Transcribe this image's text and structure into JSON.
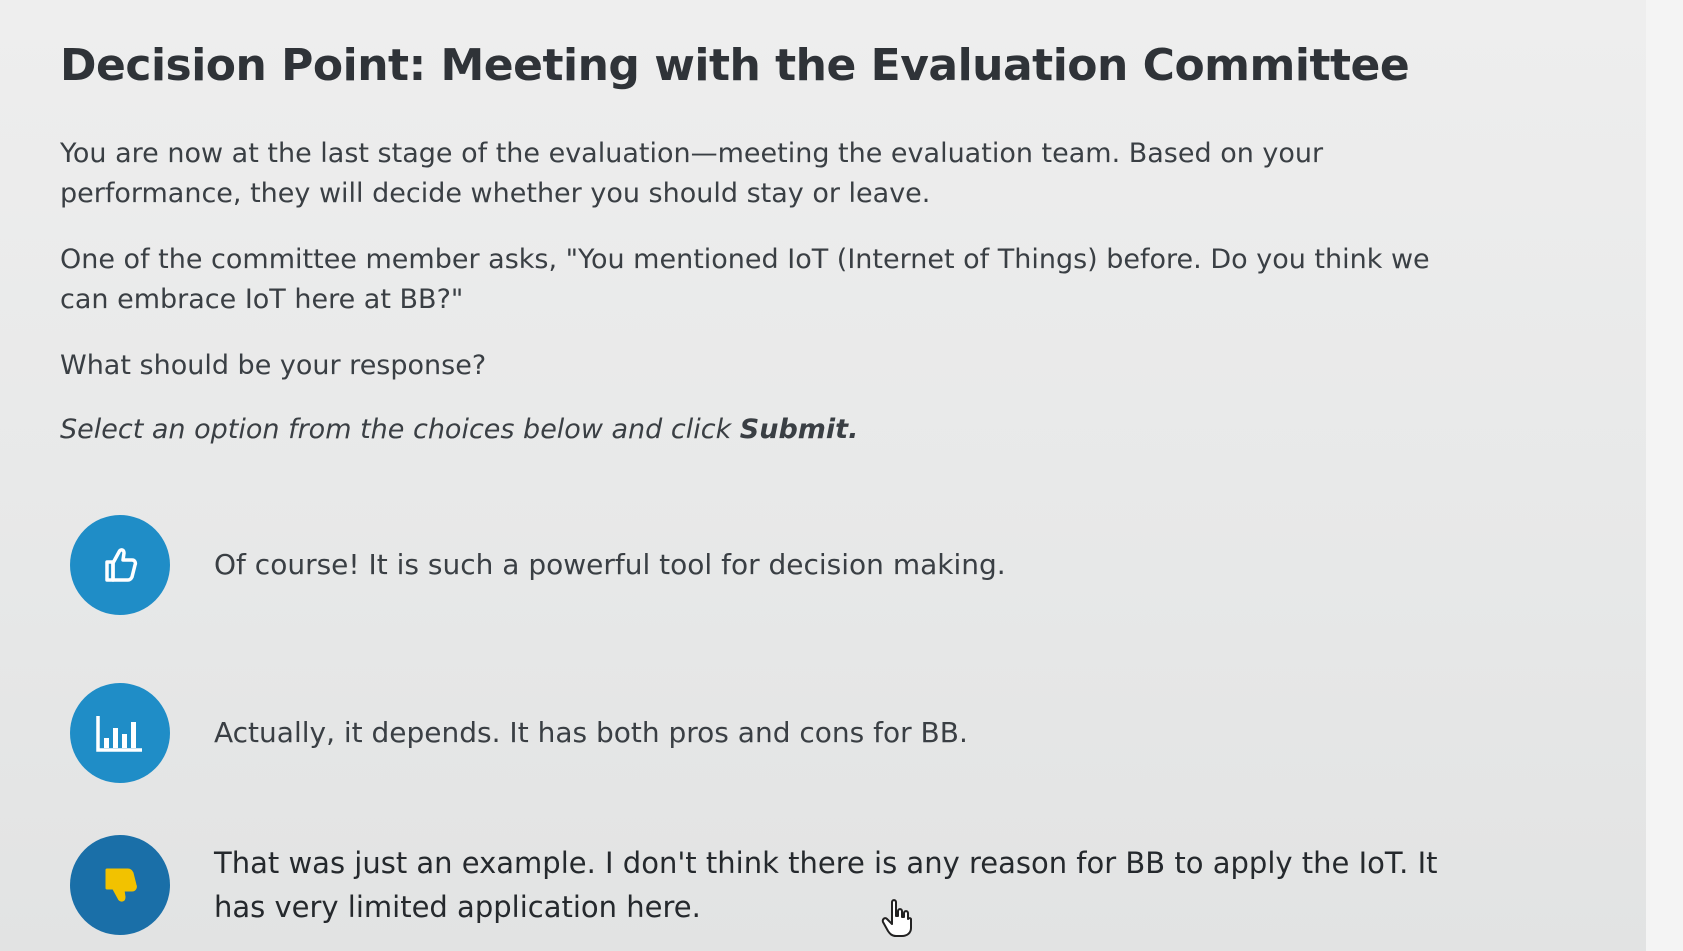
{
  "title": "Decision Point: Meeting with the Evaluation Committee",
  "paragraphs": {
    "intro": "You are now at the last stage of the evaluation—meeting the evaluation team. Based on your performance, they will decide whether you should stay or leave.",
    "question": "One of the committee member asks, \"You mentioned IoT (Internet of Things) before. Do you think we can embrace IoT here at BB?\"",
    "prompt": "What should be your response?",
    "instruction_prefix": "Select an option from the choices below and click ",
    "instruction_strong": "Submit."
  },
  "choices": [
    {
      "icon": "thumbs-up-icon",
      "text": "Of course! It is such a powerful tool for decision making."
    },
    {
      "icon": "bar-chart-icon",
      "text": "Actually, it depends. It has both pros and cons for BB."
    },
    {
      "icon": "thumbs-down-icon",
      "text": "That was just an example. I don't think there is any reason for BB to apply the IoT. It has very limited application here."
    }
  ],
  "colors": {
    "accent_blue": "#1f8dc7",
    "dark_blue": "#1a6fa8",
    "thumbs_down_yellow": "#f2c200"
  }
}
